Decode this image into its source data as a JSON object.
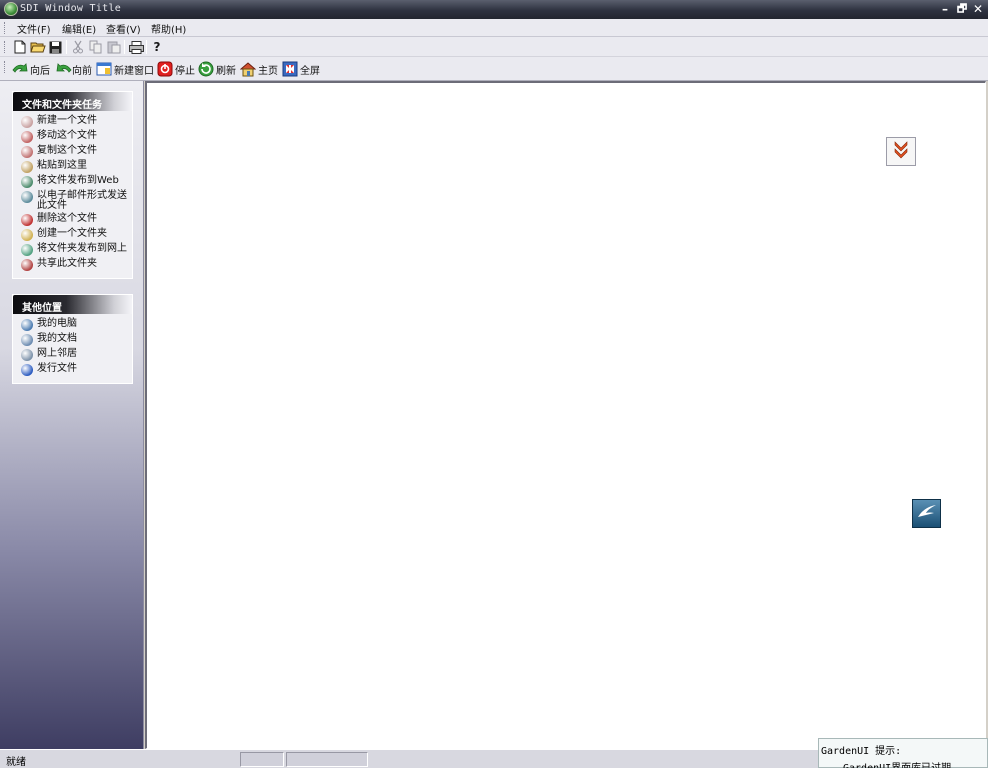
{
  "window": {
    "title": "SDI Window Title",
    "minimize_glyph": "–",
    "restore_glyph": "🗗",
    "close_glyph": "✕"
  },
  "menu": [
    {
      "label": "文件(F)"
    },
    {
      "label": "编辑(E)"
    },
    {
      "label": "查看(V)"
    },
    {
      "label": "帮助(H)"
    }
  ],
  "toolbar": {
    "icons": [
      "new-icon",
      "open-icon",
      "save-icon",
      "cut-icon",
      "copy-icon",
      "paste-icon",
      "print-icon",
      "help-icon"
    ],
    "help_glyph": "?"
  },
  "nav": {
    "back": "向后",
    "forward": "向前",
    "new_window": "新建窗口",
    "stop": "停止",
    "refresh": "刷新",
    "home": "主页",
    "fullscreen": "全屏"
  },
  "sidebar": {
    "tasks": {
      "title": "文件和文件夹任务",
      "items": [
        {
          "label": "新建一个文件",
          "icon": "new-file-icon",
          "color": "#c8a0a0"
        },
        {
          "label": "移动这个文件",
          "icon": "move-file-icon",
          "color": "#c06060"
        },
        {
          "label": "复制这个文件",
          "icon": "copy-file-icon",
          "color": "#c07070"
        },
        {
          "label": "粘贴到这里",
          "icon": "paste-here-icon",
          "color": "#c0a060"
        },
        {
          "label": "将文件发布到Web",
          "icon": "publish-web-icon",
          "color": "#4a8a6a"
        },
        {
          "label": "以电子邮件形式发送此文件",
          "icon": "email-file-icon",
          "color": "#5a8a9a"
        },
        {
          "label": "删除这个文件",
          "icon": "delete-file-icon",
          "color": "#c03030"
        },
        {
          "label": "创建一个文件夹",
          "icon": "create-folder-icon",
          "color": "#d0b050"
        },
        {
          "label": "将文件夹发布到网上",
          "icon": "publish-folder-icon",
          "color": "#50a080"
        },
        {
          "label": "共享此文件夹",
          "icon": "share-folder-icon",
          "color": "#b04040"
        }
      ]
    },
    "places": {
      "title": "其他位置",
      "items": [
        {
          "label": "我的电脑",
          "icon": "my-computer-icon",
          "color": "#4a7ab0"
        },
        {
          "label": "我的文档",
          "icon": "my-documents-icon",
          "color": "#6a8ab0"
        },
        {
          "label": "网上邻居",
          "icon": "network-icon",
          "color": "#7a90a8"
        },
        {
          "label": "发行文件",
          "icon": "info-icon",
          "color": "#2a5ac0"
        }
      ]
    }
  },
  "status": {
    "text": "就绪"
  },
  "tooltip": {
    "title": "GardenUI 提示:",
    "body": "GardenUI界面库已过期，"
  },
  "colors": {
    "titlebar": "#2e3240",
    "sidebar_bottom": "#3e3d62",
    "collapse_arrow": "#e05020",
    "bird_button": "#1a4f74"
  }
}
